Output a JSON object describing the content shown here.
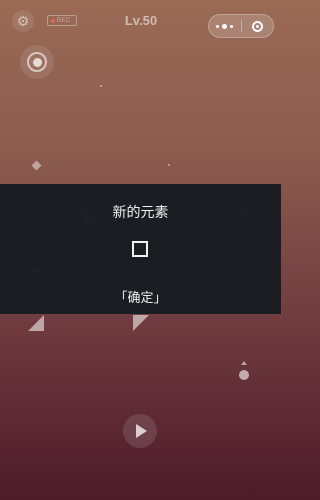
{
  "header": {
    "rec_label": "REC",
    "level_label": "Lv.50"
  },
  "modal": {
    "title": "新的元素",
    "confirm_label": "「确定」"
  }
}
